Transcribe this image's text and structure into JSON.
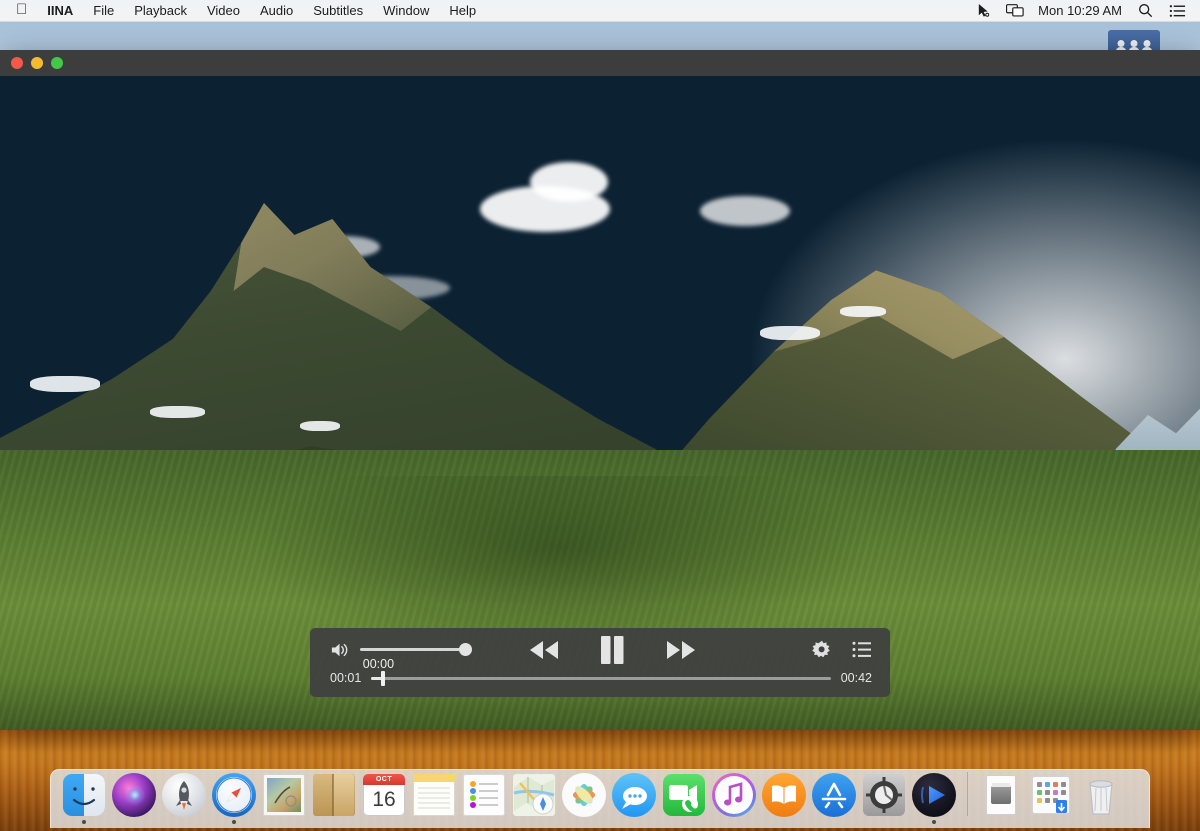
{
  "menubar": {
    "apple_icon": "apple-logo-icon",
    "items": [
      {
        "label": "IINA",
        "bold": true
      },
      {
        "label": "File",
        "bold": false
      },
      {
        "label": "Playback",
        "bold": false
      },
      {
        "label": "Video",
        "bold": false
      },
      {
        "label": "Audio",
        "bold": false
      },
      {
        "label": "Subtitles",
        "bold": false
      },
      {
        "label": "Window",
        "bold": false
      },
      {
        "label": "Help",
        "bold": false
      }
    ],
    "status": {
      "cursor_icon": "pointer-icon",
      "screen_icon": "screen-mirroring-icon",
      "clock": "Mon 10:29 AM",
      "search_icon": "search-icon",
      "control_center_icon": "list-menu-icon"
    }
  },
  "desktop": {
    "users_widget": {
      "name": "users-and-groups-icon",
      "color": "#3c5f96"
    }
  },
  "window": {
    "title": "",
    "traffic_lights": [
      {
        "name": "close-button",
        "color": "#f3584b"
      },
      {
        "name": "minimize-button",
        "color": "#f5bb30"
      },
      {
        "name": "zoom-button",
        "color": "#42c948"
      }
    ]
  },
  "player": {
    "volume": {
      "icon": "volume-high-icon",
      "level_percent": 100
    },
    "transport": {
      "rewind_icon": "rewind-icon",
      "playpause_icon": "pause-icon",
      "fastforward_icon": "fast-forward-icon"
    },
    "right_controls": [
      {
        "name": "settings-gear-icon",
        "label": "gear"
      },
      {
        "name": "playlist-icon",
        "label": "playlist"
      }
    ],
    "seek": {
      "elapsed": "00:01",
      "remaining": "00:42",
      "tooltip": "00:00",
      "progress_percent": 2.5
    }
  },
  "dock": {
    "items": [
      {
        "name": "dock-item-finder",
        "label": "Finder",
        "running": true
      },
      {
        "name": "dock-item-siri",
        "label": "Siri",
        "running": false
      },
      {
        "name": "dock-item-launchpad",
        "label": "Launchpad",
        "running": false
      },
      {
        "name": "dock-item-safari",
        "label": "Safari",
        "running": true
      },
      {
        "name": "dock-item-mail",
        "label": "Mail",
        "running": false
      },
      {
        "name": "dock-item-contacts",
        "label": "Contacts",
        "running": false
      },
      {
        "name": "dock-item-calendar",
        "label": "Calendar",
        "running": false,
        "badge_month": "OCT",
        "badge_day": "16"
      },
      {
        "name": "dock-item-notes",
        "label": "Notes",
        "running": false
      },
      {
        "name": "dock-item-reminders",
        "label": "Reminders",
        "running": false
      },
      {
        "name": "dock-item-maps",
        "label": "Maps",
        "running": false
      },
      {
        "name": "dock-item-photos",
        "label": "Photos",
        "running": false
      },
      {
        "name": "dock-item-messages",
        "label": "Messages",
        "running": false
      },
      {
        "name": "dock-item-facetime",
        "label": "FaceTime",
        "running": false
      },
      {
        "name": "dock-item-itunes",
        "label": "iTunes",
        "running": false
      },
      {
        "name": "dock-item-ibooks",
        "label": "iBooks",
        "running": false
      },
      {
        "name": "dock-item-app-store",
        "label": "App Store",
        "running": false
      },
      {
        "name": "dock-item-system-preferences",
        "label": "System Preferences",
        "running": false
      },
      {
        "name": "dock-item-iina",
        "label": "IINA",
        "running": true
      }
    ],
    "right_items": [
      {
        "name": "dock-item-document",
        "label": "Document"
      },
      {
        "name": "dock-item-downloads-folder",
        "label": "Downloads"
      },
      {
        "name": "dock-item-trash",
        "label": "Trash"
      }
    ]
  }
}
